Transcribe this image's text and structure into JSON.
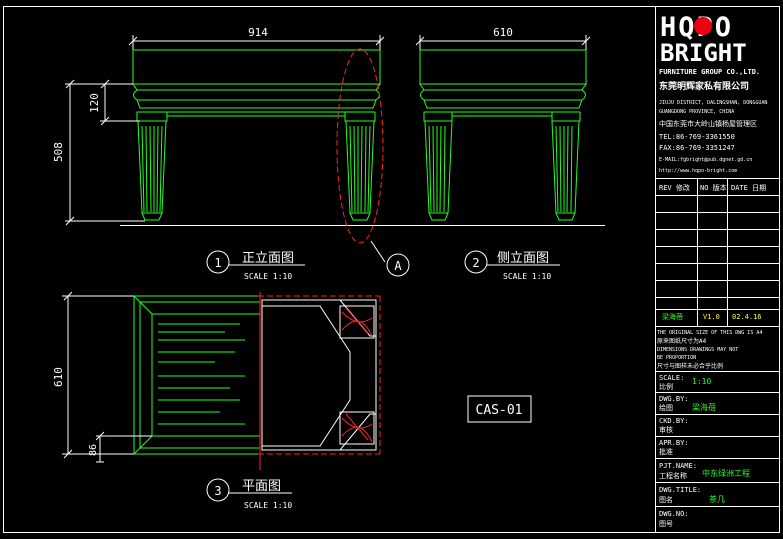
{
  "dimensions": {
    "front_width": "914",
    "side_width": "610",
    "height": "508",
    "top_height": "120",
    "plan_depth": "610",
    "plan_small": "86"
  },
  "views": {
    "front": {
      "number": "1",
      "title": "正立面图",
      "scale": "SCALE 1:10"
    },
    "side": {
      "number": "2",
      "title": "侧立面图",
      "scale": "SCALE 1:10"
    },
    "plan": {
      "number": "3",
      "title": "平面图",
      "scale": "SCALE 1:10"
    }
  },
  "detail_marker": "A",
  "drawing_code": "CAS-01",
  "title_block": {
    "logo_top": "HQPO",
    "logo_bottom": "BRIGHT",
    "company_en": "FURNITURE GROUP CO.,LTD.",
    "company_cn": "东莞明辉家私有限公司",
    "address_1": "JIUJU DISTRICT, DALINGSHAN, DONGGUAN",
    "address_2": "GUANGDONG PROVINCE, CHINA",
    "address_cn": "中国东莞市大岭山镇杨屋管理区",
    "tel": "TEL:86-769-3361550",
    "fax": "FAX:86-769-3351247",
    "email": "E-MAIL:fgbright@pub.dgnet.gd.cn",
    "web": "http://www.hqpo-bright.com",
    "rev_header": {
      "rev": "REV 修改",
      "no": "NO 版本",
      "date": "DATE 日期"
    },
    "rev_entry": {
      "name": "梁海蓓",
      "version": "V1.0",
      "date": "02.4.16"
    },
    "notes_1": "THE ORIGINAL SIZE OF THIS DWG IS A4",
    "notes_2": "原来图纸尺寸为A4",
    "notes_3": "DIMENSIONS DRAWINGS MAY NOT",
    "notes_4": "BE PROPORTION",
    "notes_5": "尺寸与图样未必合乎比例",
    "scale_label": "SCALE:",
    "scale_label_cn": "比例",
    "scale_value": "1:10",
    "dwg_by_label": "DWG.BY:",
    "dwg_by_label_cn": "绘图",
    "dwg_by_value": "梁海蓓",
    "ckd_by_label": "CKD.BY:",
    "ckd_by_label_cn": "审核",
    "apr_by_label": "APR.BY:",
    "apr_by_label_cn": "批准",
    "pjt_label": "PJT.NAME:",
    "pjt_label_cn": "工程名称",
    "pjt_value": "中东绿洲工程",
    "title_label": "DWG.TITLE:",
    "title_label_cn": "图名",
    "title_value": "茶几",
    "no_label": "DWG.NO:",
    "no_label_cn": "图号"
  }
}
